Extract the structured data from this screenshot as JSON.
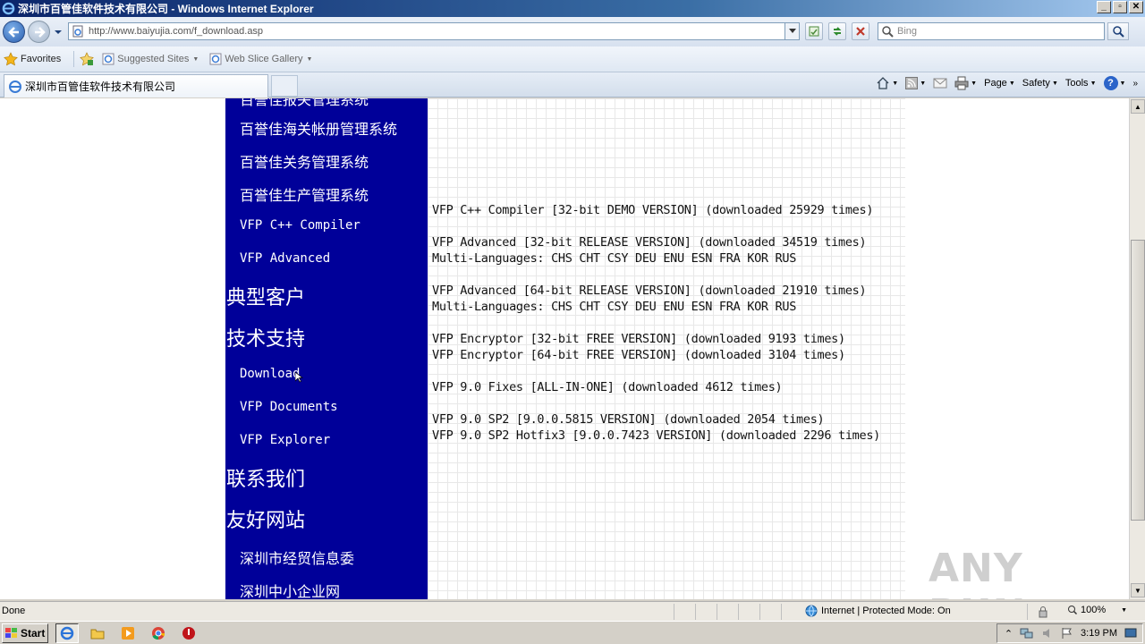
{
  "window": {
    "title": "深圳市百管佳软件技术有限公司 - Windows Internet Explorer",
    "minimize": "_",
    "restore": "▫",
    "close": "✕"
  },
  "address_bar": {
    "url": "http://www.baiyujia.com/f_download.asp",
    "search_placeholder": "Bing"
  },
  "favorites_bar": {
    "favorites_label": "Favorites",
    "suggested_sites": "Suggested Sites",
    "web_slice_gallery": "Web Slice Gallery"
  },
  "tab": {
    "title": "深圳市百管佳软件技术有限公司"
  },
  "command_bar": {
    "page": "Page",
    "safety": "Safety",
    "tools": "Tools",
    "help": "?"
  },
  "sidebar": {
    "partial_top": "百誉佳报关管理系统",
    "items": [
      {
        "label": "百誉佳海关帐册管理系统"
      },
      {
        "label": "百誉佳关务管理系统"
      },
      {
        "label": "百誉佳生产管理系统"
      },
      {
        "label": "VFP C++ Compiler"
      },
      {
        "label": "VFP Advanced"
      }
    ],
    "heading_customers": "典型客户",
    "heading_support": "技术支持",
    "support_items": [
      {
        "label": "Download"
      },
      {
        "label": "VFP Documents"
      },
      {
        "label": "VFP Explorer"
      }
    ],
    "heading_contact": "联系我们",
    "heading_links": "友好网站",
    "link_items": [
      {
        "label": "深圳市经贸信息委"
      },
      {
        "label": "深圳中小企业网"
      }
    ]
  },
  "downloads": [
    "VFP C++ Compiler [32-bit DEMO VERSION] (downloaded 25929 times)",
    "VFP Advanced [32-bit RELEASE VERSION] (downloaded 34519 times)",
    "Multi-Languages: CHS CHT CSY DEU ENU ESN FRA KOR RUS",
    "VFP Advanced [64-bit RELEASE VERSION] (downloaded 21910 times)",
    "Multi-Languages: CHS CHT CSY DEU ENU ESN FRA KOR RUS",
    "VFP Encryptor [32-bit FREE VERSION] (downloaded 9193 times)",
    "VFP Encryptor [64-bit FREE VERSION] (downloaded 3104 times)",
    "VFP 9.0 Fixes [ALL-IN-ONE] (downloaded 4612 times)",
    "VFP 9.0 SP2 [9.0.0.5815 VERSION] (downloaded 2054 times)",
    "VFP 9.0 SP2 Hotfix3 [9.0.0.7423 VERSION] (downloaded 2296 times)"
  ],
  "watermark": "ANY RUN",
  "status_bar": {
    "status": "Done",
    "zone": "Internet | Protected Mode: On",
    "zoom": "100%"
  },
  "taskbar": {
    "start": "Start",
    "clock": "3:19 PM"
  },
  "colors": {
    "sidebar_bg": "#000099",
    "title_bar": "#0a246a"
  }
}
